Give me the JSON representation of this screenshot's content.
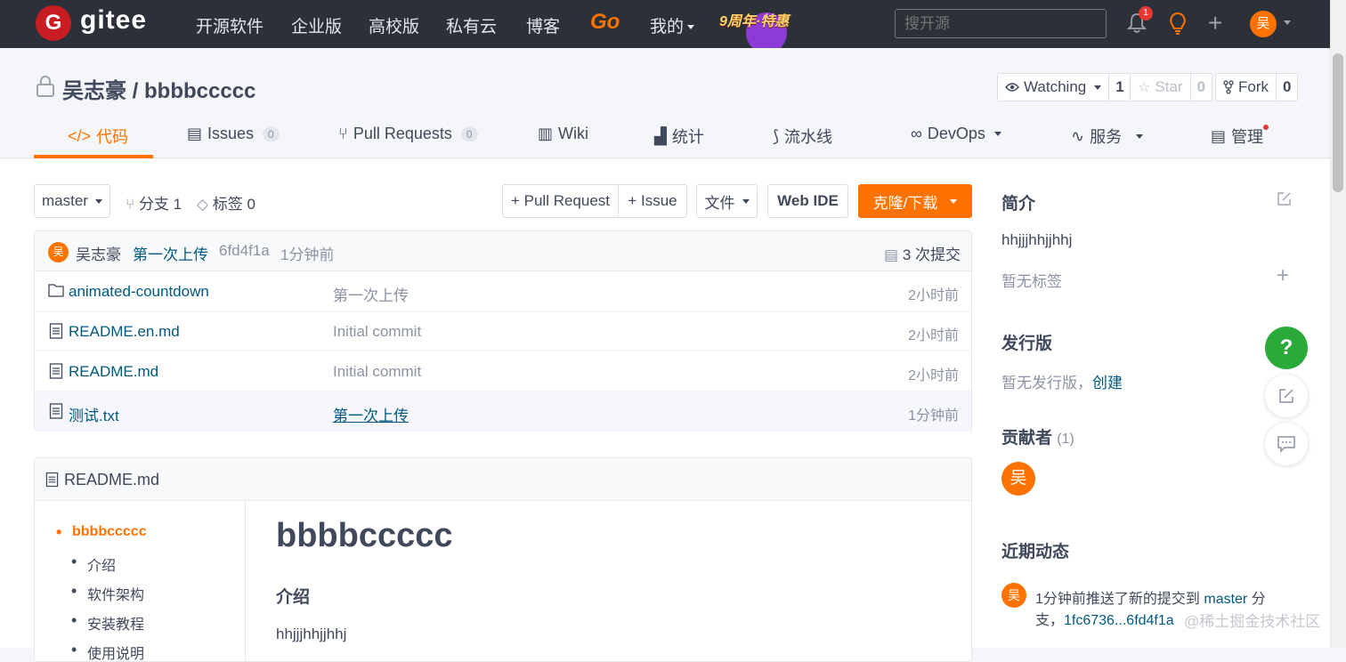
{
  "topnav": {
    "logo_letter": "G",
    "logo_text": "gitee",
    "items": [
      "开源软件",
      "企业版",
      "高校版",
      "私有云",
      "博客"
    ],
    "go_label": "Go",
    "mine_label": "我的",
    "promo_text": "9周年·特惠",
    "search_placeholder": "搜开源",
    "notif_count": "1",
    "avatar_letter": "吴"
  },
  "repo": {
    "owner": "吴志豪",
    "separator": " / ",
    "name": "bbbbccccc",
    "watch_label": "Watching",
    "watch_count": "1",
    "star_label": "Star",
    "star_count": "0",
    "fork_label": "Fork",
    "fork_count": "0"
  },
  "tabs": {
    "code": "代码",
    "issues": "Issues",
    "issues_count": "0",
    "pulls": "Pull Requests",
    "pulls_count": "0",
    "wiki": "Wiki",
    "stats": "统计",
    "pipeline": "流水线",
    "devops": "DevOps",
    "services": "服务",
    "manage": "管理"
  },
  "toolbar": {
    "branch": "master",
    "branches_label": "分支 1",
    "tags_label": "标签 0",
    "pull_request": "+ Pull Request",
    "issue": "+ Issue",
    "file": "文件",
    "web_ide": "Web IDE",
    "clone": "克隆/下载"
  },
  "commit": {
    "avatar": "吴",
    "author": "吴志豪",
    "message": "第一次上传",
    "hash": "6fd4f1a",
    "time": "1分钟前",
    "count_label": "3 次提交"
  },
  "files": [
    {
      "name": "animated-countdown",
      "type": "folder",
      "message": "第一次上传",
      "time": "2小时前"
    },
    {
      "name": "README.en.md",
      "type": "file",
      "message": "Initial commit",
      "time": "2小时前"
    },
    {
      "name": "README.md",
      "type": "file",
      "message": "Initial commit",
      "time": "2小时前"
    },
    {
      "name": "测试.txt",
      "type": "file",
      "message": "第一次上传",
      "time": "1分钟前"
    }
  ],
  "readme": {
    "filename": "README.md",
    "toc": [
      "bbbbccccc",
      "介绍",
      "软件架构",
      "安装教程",
      "使用说明"
    ],
    "title": "bbbbccccc",
    "section": "介绍",
    "body": "hhjjjhhjjhhj"
  },
  "sidebar": {
    "intro_title": "简介",
    "intro_text": "hhjjjhhjjhhj",
    "no_tags": "暂无标签",
    "releases_title": "发行版",
    "no_releases": "暂无发行版，",
    "create_link": "创建",
    "contributors_title": "贡献者",
    "contributors_count": "(1)",
    "contributor_avatar": "吴",
    "activity_title": "近期动态",
    "activity_avatar": "吴",
    "activity_line1_a": "1分钟前推送了新的提交到 ",
    "activity_line1_link": "master",
    "activity_line1_b": " 分",
    "activity_line2_a": "支，",
    "activity_line2_link": "1fc6736...6fd4f1a"
  },
  "watermark": "@稀土掘金技术社区",
  "colors": {
    "accent": "#fe7300",
    "link": "#005980",
    "nav_bg": "#2c3038",
    "help_green": "#2baa3a"
  }
}
